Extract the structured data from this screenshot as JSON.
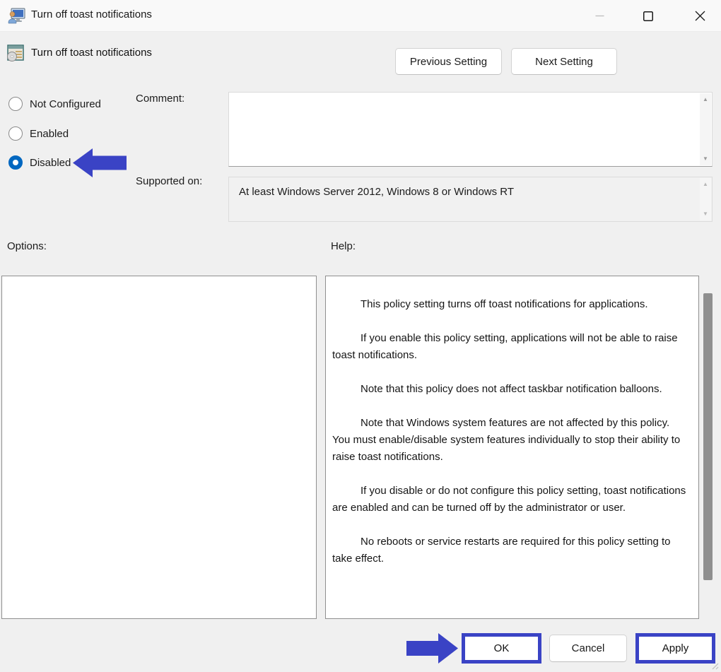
{
  "window": {
    "title": "Turn off toast notifications",
    "controls": {
      "minimize": "minimize",
      "maximize": "maximize",
      "close": "close"
    }
  },
  "header": {
    "setting_title": "Turn off toast notifications",
    "previous_button_label": "Previous Setting",
    "next_button_label": "Next Setting"
  },
  "config": {
    "radios": [
      {
        "label": "Not Configured",
        "selected": false
      },
      {
        "label": "Enabled",
        "selected": false
      },
      {
        "label": "Disabled",
        "selected": true
      }
    ],
    "comment_label": "Comment:",
    "comment_value": "",
    "supported_label": "Supported on:",
    "supported_value": "At least Windows Server 2012, Windows 8 or Windows RT"
  },
  "panels": {
    "options_label": "Options:",
    "help_label": "Help:",
    "help_paragraphs": [
      "This policy setting turns off toast notifications for applications.",
      "If you enable this policy setting, applications will not be able to raise toast notifications.",
      "Note that this policy does not affect taskbar notification balloons.",
      "Note that Windows system features are not affected by this policy.  You must enable/disable system features individually to stop their ability to raise toast notifications.",
      "If you disable or do not configure this policy setting, toast notifications are enabled and can be turned off by the administrator or user.",
      "No reboots or service restarts are required for this policy setting to take effect."
    ]
  },
  "footer": {
    "ok_label": "OK",
    "cancel_label": "Cancel",
    "apply_label": "Apply"
  },
  "annotations": {
    "arrow_color": "#3a43c5",
    "highlight_border_color": "#3a43c5"
  },
  "colors": {
    "radio_selected": "#0067c0",
    "titlebar_bg": "#f9f9f9",
    "body_bg": "#f0f0f0"
  }
}
